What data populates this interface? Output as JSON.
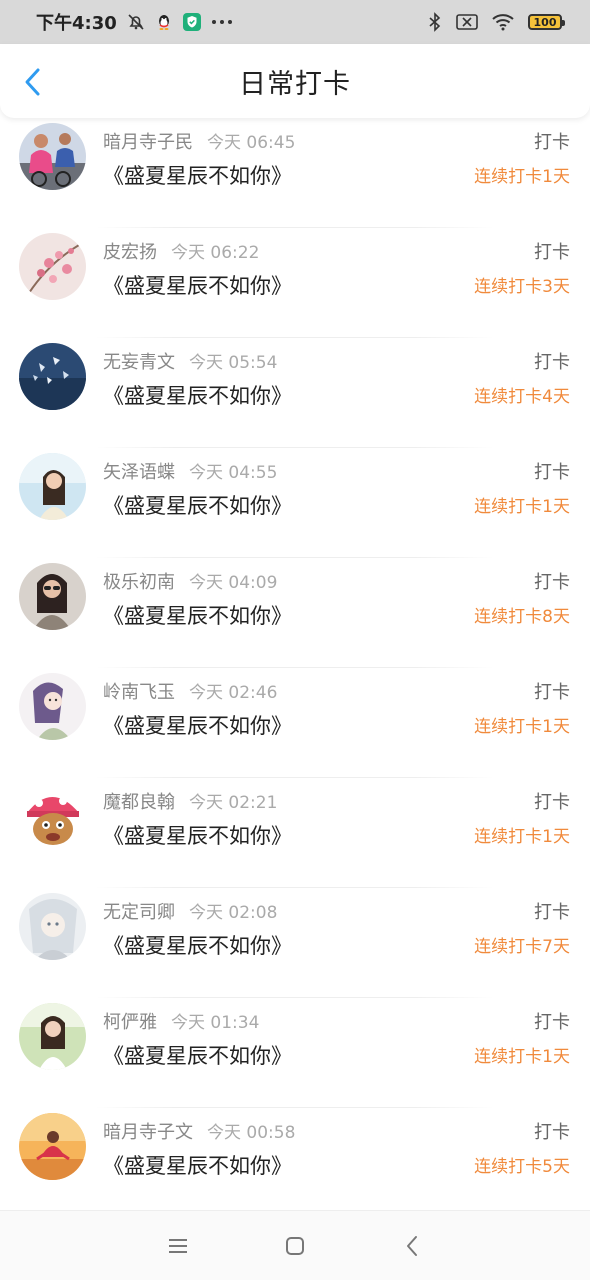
{
  "status_bar": {
    "time": "下午4:30",
    "battery": "100",
    "icons": [
      "mute-bell-icon",
      "qq-icon",
      "shield-app-icon",
      "more-dots-icon",
      "bluetooth-icon",
      "sim-x-icon",
      "wifi-icon",
      "battery-icon"
    ]
  },
  "header": {
    "title": "日常打卡",
    "back_icon": "chevron-left-icon"
  },
  "items": [
    {
      "name": "暗月寺子民",
      "time": "今天 06:45",
      "book": "《盛夏星辰不如你》",
      "action": "打卡",
      "streak": "连续打卡1天"
    },
    {
      "name": "皮宏扬",
      "time": "今天 06:22",
      "book": "《盛夏星辰不如你》",
      "action": "打卡",
      "streak": "连续打卡3天"
    },
    {
      "name": "无妄青文",
      "time": "今天 05:54",
      "book": "《盛夏星辰不如你》",
      "action": "打卡",
      "streak": "连续打卡4天"
    },
    {
      "name": "矢泽语蝶",
      "time": "今天 04:55",
      "book": "《盛夏星辰不如你》",
      "action": "打卡",
      "streak": "连续打卡1天"
    },
    {
      "name": "极乐初南",
      "time": "今天 04:09",
      "book": "《盛夏星辰不如你》",
      "action": "打卡",
      "streak": "连续打卡8天"
    },
    {
      "name": "岭南飞玉",
      "time": "今天 02:46",
      "book": "《盛夏星辰不如你》",
      "action": "打卡",
      "streak": "连续打卡1天"
    },
    {
      "name": "魔都良翰",
      "time": "今天 02:21",
      "book": "《盛夏星辰不如你》",
      "action": "打卡",
      "streak": "连续打卡1天"
    },
    {
      "name": "无定司卿",
      "time": "今天 02:08",
      "book": "《盛夏星辰不如你》",
      "action": "打卡",
      "streak": "连续打卡7天"
    },
    {
      "name": "柯俨雅",
      "time": "今天 01:34",
      "book": "《盛夏星辰不如你》",
      "action": "打卡",
      "streak": "连续打卡1天"
    },
    {
      "name": "暗月寺子文",
      "time": "今天 00:58",
      "book": "《盛夏星辰不如你》",
      "action": "打卡",
      "streak": "连续打卡5天"
    }
  ],
  "colors": {
    "streak": "#f08a3c",
    "back_accent": "#2f9bf0",
    "statusbar_bg": "#d9d9d9"
  },
  "nav_bar": {
    "icons": [
      "menu-icon",
      "home-square-icon",
      "back-triangle-icon"
    ]
  }
}
